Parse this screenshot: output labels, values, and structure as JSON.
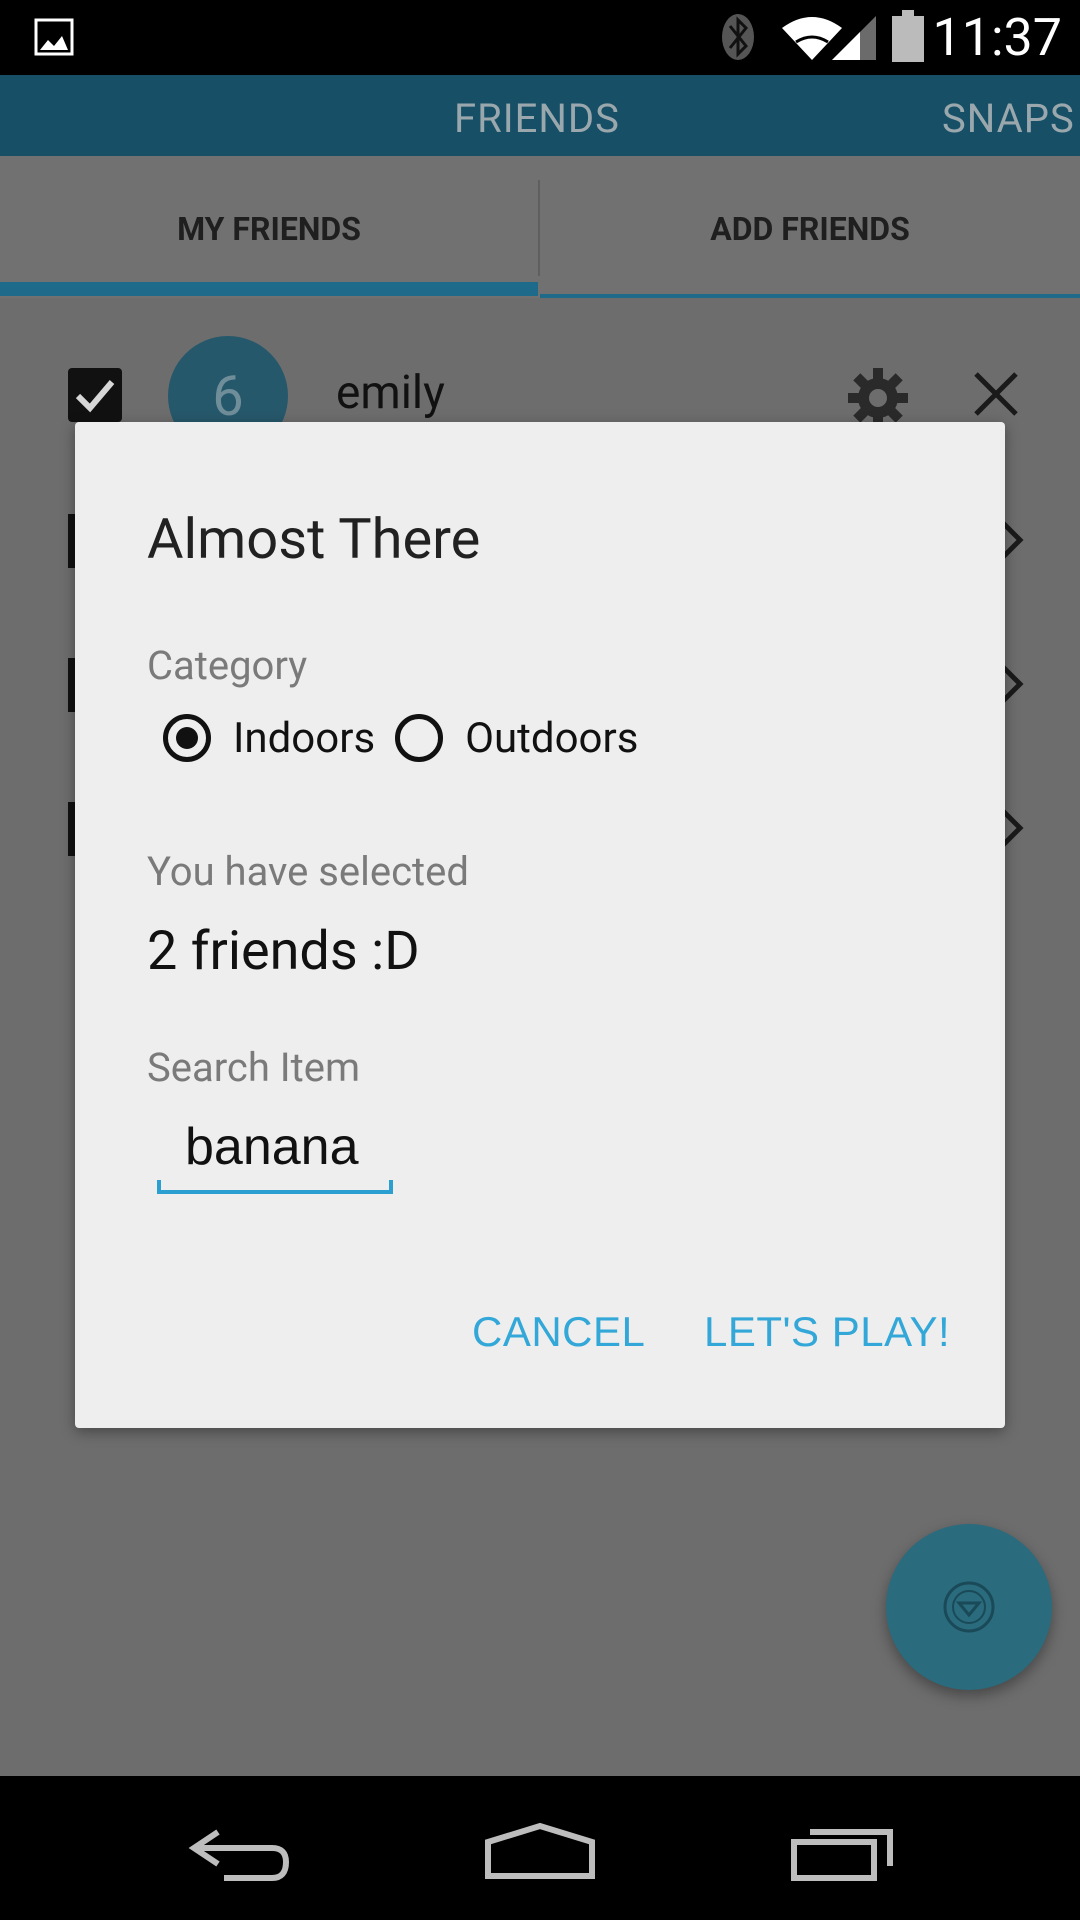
{
  "status_bar": {
    "time": "11:37"
  },
  "top_tabs": {
    "friends": "FRIENDS",
    "snaps": "SNAPS"
  },
  "sub_tabs": {
    "my_friends": "MY FRIENDS",
    "add_friends": "ADD FRIENDS"
  },
  "friend_list": [
    {
      "name": "emily",
      "avatar": "6",
      "checked": true
    }
  ],
  "dialog": {
    "title": "Almost There",
    "category_label": "Category",
    "options": [
      {
        "label": "Indoors",
        "selected": true
      },
      {
        "label": "Outdoors",
        "selected": false
      }
    ],
    "selected_label": "You have selected",
    "selected_value": "2 friends :D",
    "search_label": "Search Item",
    "search_value": "banana",
    "cancel": "CANCEL",
    "confirm": "LET'S PLAY!"
  },
  "colors": {
    "accent": "#33a8d8",
    "tab_indicator": "#1e6a8a",
    "fab": "#2a6b7e"
  },
  "icons": {
    "status_left": "image-icon",
    "bluetooth": "bluetooth-icon",
    "wifi": "wifi-icon",
    "signal": "signal-icon",
    "battery": "battery-icon",
    "settings": "gear-icon",
    "remove": "close-icon",
    "fab": "dropdown-circle-icon",
    "nav_back": "back-icon",
    "nav_home": "home-icon",
    "nav_recents": "recents-icon"
  }
}
